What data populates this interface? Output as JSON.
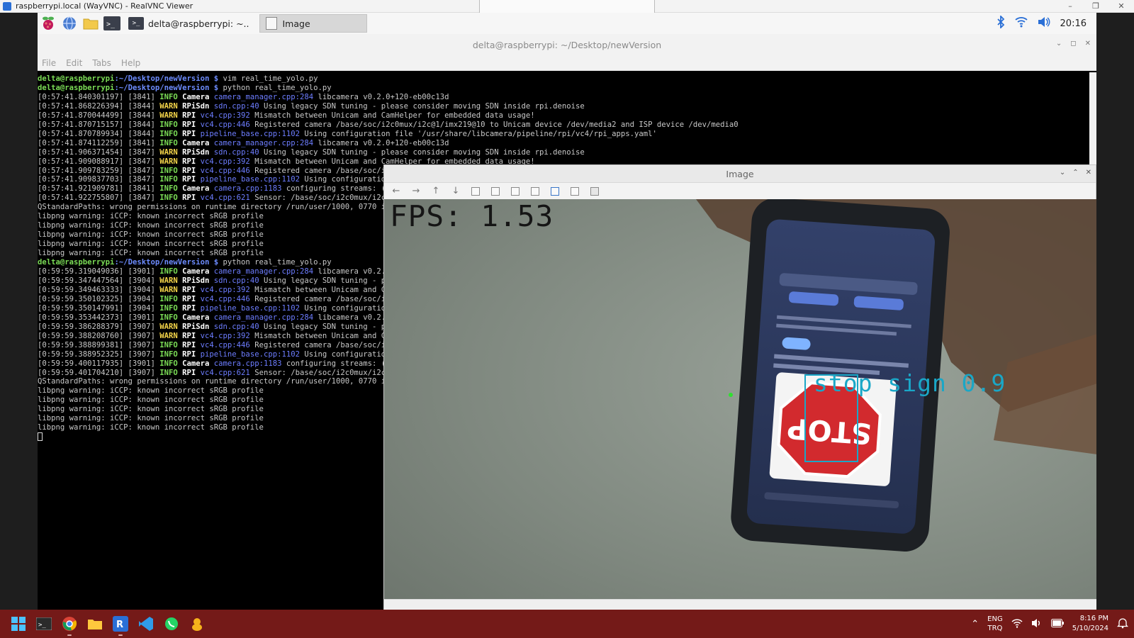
{
  "vnc": {
    "title": "raspberrypi.local (WayVNC) - RealVNC Viewer",
    "minimize": "–",
    "restore": "❐",
    "close": "✕"
  },
  "pi_panel": {
    "tasks": [
      {
        "label": "delta@raspberrypi: ~..",
        "active": false
      },
      {
        "label": "Image",
        "active": true
      }
    ],
    "clock": "20:16"
  },
  "terminal": {
    "title": "delta@raspberrypi: ~/Desktop/newVersion",
    "menu": [
      "File",
      "Edit",
      "Tabs",
      "Help"
    ],
    "prompt_user": "delta@raspberrypi",
    "prompt_path": ":~/Desktop/newVersion $",
    "lines": [
      {
        "t": "prompt",
        "cmd": " vim real_time_yolo.py"
      },
      {
        "t": "prompt",
        "cmd": " python real_time_yolo.py"
      },
      {
        "t": "log",
        "ts": "[0:57:41.840301197] [3841]",
        "lvl": "INFO",
        "cat": "Camera",
        "src": "camera_manager.cpp:284",
        "msg": "libcamera v0.2.0+120-eb00c13d"
      },
      {
        "t": "log",
        "ts": "[0:57:41.868226394] [3844]",
        "lvl": "WARN",
        "cat": "RPiSdn",
        "src": "sdn.cpp:40",
        "msg": "Using legacy SDN tuning - please consider moving SDN inside rpi.denoise"
      },
      {
        "t": "log",
        "ts": "[0:57:41.870044499] [3844]",
        "lvl": "WARN",
        "cat": "RPI",
        "src": "vc4.cpp:392",
        "msg": "Mismatch between Unicam and CamHelper for embedded data usage!"
      },
      {
        "t": "log",
        "ts": "[0:57:41.870715157] [3844]",
        "lvl": "INFO",
        "cat": "RPI",
        "src": "vc4.cpp:446",
        "msg": "Registered camera /base/soc/i2c0mux/i2c@1/imx219@10 to Unicam device /dev/media2 and ISP device /dev/media0"
      },
      {
        "t": "log",
        "ts": "[0:57:41.870789934] [3844]",
        "lvl": "INFO",
        "cat": "RPI",
        "src": "pipeline_base.cpp:1102",
        "msg": "Using configuration file '/usr/share/libcamera/pipeline/rpi/vc4/rpi_apps.yaml'"
      },
      {
        "t": "log",
        "ts": "[0:57:41.874112259] [3841]",
        "lvl": "INFO",
        "cat": "Camera",
        "src": "camera_manager.cpp:284",
        "msg": "libcamera v0.2.0+120-eb00c13d"
      },
      {
        "t": "log",
        "ts": "[0:57:41.906371454] [3847]",
        "lvl": "WARN",
        "cat": "RPiSdn",
        "src": "sdn.cpp:40",
        "msg": "Using legacy SDN tuning - please consider moving SDN inside rpi.denoise"
      },
      {
        "t": "log",
        "ts": "[0:57:41.909088917] [3847]",
        "lvl": "WARN",
        "cat": "RPI",
        "src": "vc4.cpp:392",
        "msg": "Mismatch between Unicam and CamHelper for embedded data usage!"
      },
      {
        "t": "log",
        "ts": "[0:57:41.909783259] [3847]",
        "lvl": "INFO",
        "cat": "RPI",
        "src": "vc4.cpp:446",
        "msg": "Registered camera /base/soc/i2c0mux/i2c@1/imx219@10 to Unicam device /dev/media2 and ISP device /dev/media0"
      },
      {
        "t": "log",
        "ts": "[0:57:41.909837703] [3847]",
        "lvl": "INFO",
        "cat": "RPI",
        "src": "pipeline_base.cpp:1102",
        "msg": "Using configuration"
      },
      {
        "t": "log",
        "ts": "[0:57:41.921909781] [3841]",
        "lvl": "INFO",
        "cat": "Camera",
        "src": "camera.cpp:1183",
        "msg": "configuring streams: (0)"
      },
      {
        "t": "log",
        "ts": "[0:57:41.922755807] [3847]",
        "lvl": "INFO",
        "cat": "RPI",
        "src": "vc4.cpp:621",
        "msg": "Sensor: /base/soc/i2c0mux/i2c@"
      },
      {
        "t": "plain",
        "text": "QStandardPaths: wrong permissions on runtime directory /run/user/1000, 0770 inst"
      },
      {
        "t": "plain",
        "text": "libpng warning: iCCP: known incorrect sRGB profile"
      },
      {
        "t": "plain",
        "text": "libpng warning: iCCP: known incorrect sRGB profile"
      },
      {
        "t": "plain",
        "text": "libpng warning: iCCP: known incorrect sRGB profile"
      },
      {
        "t": "plain",
        "text": "libpng warning: iCCP: known incorrect sRGB profile"
      },
      {
        "t": "plain",
        "text": "libpng warning: iCCP: known incorrect sRGB profile"
      },
      {
        "t": "prompt",
        "cmd": " python real_time_yolo.py"
      },
      {
        "t": "log",
        "ts": "[0:59:59.319049036] [3901]",
        "lvl": "INFO",
        "cat": "Camera",
        "src": "camera_manager.cpp:284",
        "msg": "libcamera v0.2.0+"
      },
      {
        "t": "log",
        "ts": "[0:59:59.347447564] [3904]",
        "lvl": "WARN",
        "cat": "RPiSdn",
        "src": "sdn.cpp:40",
        "msg": "Using legacy SDN tuning - ple"
      },
      {
        "t": "log",
        "ts": "[0:59:59.349463333] [3904]",
        "lvl": "WARN",
        "cat": "RPI",
        "src": "vc4.cpp:392",
        "msg": "Mismatch between Unicam and Cam"
      },
      {
        "t": "log",
        "ts": "[0:59:59.350102325] [3904]",
        "lvl": "INFO",
        "cat": "RPI",
        "src": "vc4.cpp:446",
        "msg": "Registered camera /base/soc/i2c"
      },
      {
        "t": "log",
        "ts": "[0:59:59.350147991] [3904]",
        "lvl": "INFO",
        "cat": "RPI",
        "src": "pipeline_base.cpp:1102",
        "msg": "Using configuration"
      },
      {
        "t": "log",
        "ts": "[0:59:59.353442373] [3901]",
        "lvl": "INFO",
        "cat": "Camera",
        "src": "camera_manager.cpp:284",
        "msg": "libcamera v0.2.0+"
      },
      {
        "t": "log",
        "ts": "[0:59:59.386288379] [3907]",
        "lvl": "WARN",
        "cat": "RPiSdn",
        "src": "sdn.cpp:40",
        "msg": "Using legacy SDN tuning - ple"
      },
      {
        "t": "log",
        "ts": "[0:59:59.388208760] [3907]",
        "lvl": "WARN",
        "cat": "RPI",
        "src": "vc4.cpp:392",
        "msg": "Mismatch between Unicam and Cam"
      },
      {
        "t": "log",
        "ts": "[0:59:59.388899381] [3907]",
        "lvl": "INFO",
        "cat": "RPI",
        "src": "vc4.cpp:446",
        "msg": "Registered camera /base/soc/i2c"
      },
      {
        "t": "log",
        "ts": "[0:59:59.388952325] [3907]",
        "lvl": "INFO",
        "cat": "RPI",
        "src": "pipeline_base.cpp:1102",
        "msg": "Using configuration"
      },
      {
        "t": "log",
        "ts": "[0:59:59.400117935] [3901]",
        "lvl": "INFO",
        "cat": "Camera",
        "src": "camera.cpp:1183",
        "msg": "configuring streams: (0)"
      },
      {
        "t": "log",
        "ts": "[0:59:59.401704210] [3907]",
        "lvl": "INFO",
        "cat": "RPI",
        "src": "vc4.cpp:621",
        "msg": "Sensor: /base/soc/i2c0mux/i2c@1"
      },
      {
        "t": "plain",
        "text": "QStandardPaths: wrong permissions on runtime directory /run/user/1000, 0770 inst"
      },
      {
        "t": "plain",
        "text": "libpng warning: iCCP: known incorrect sRGB profile"
      },
      {
        "t": "plain",
        "text": "libpng warning: iCCP: known incorrect sRGB profile"
      },
      {
        "t": "plain",
        "text": "libpng warning: iCCP: known incorrect sRGB profile"
      },
      {
        "t": "plain",
        "text": "libpng warning: iCCP: known incorrect sRGB profile"
      },
      {
        "t": "plain",
        "text": "libpng warning: iCCP: known incorrect sRGB profile"
      }
    ]
  },
  "image_window": {
    "title": "Image",
    "fps_text": "FPS: 1.53",
    "detection_label": "stop sign 0.9",
    "sign_text": "STOP",
    "toolbar": [
      "back-icon",
      "forward-icon",
      "up-icon",
      "down-icon",
      "zoom-in-icon",
      "zoom-out-icon",
      "zoom-fit-icon",
      "zoom-reset-icon",
      "save-icon",
      "copy-icon",
      "properties-icon"
    ]
  },
  "win_taskbar": {
    "lang_top": "ENG",
    "lang_bottom": "TRQ",
    "time": "8:16 PM",
    "date": "5/10/2024"
  },
  "colors": {
    "taskbar": "#741a18",
    "detection": "#1aa7c7",
    "prompt": "#7bdc56"
  }
}
